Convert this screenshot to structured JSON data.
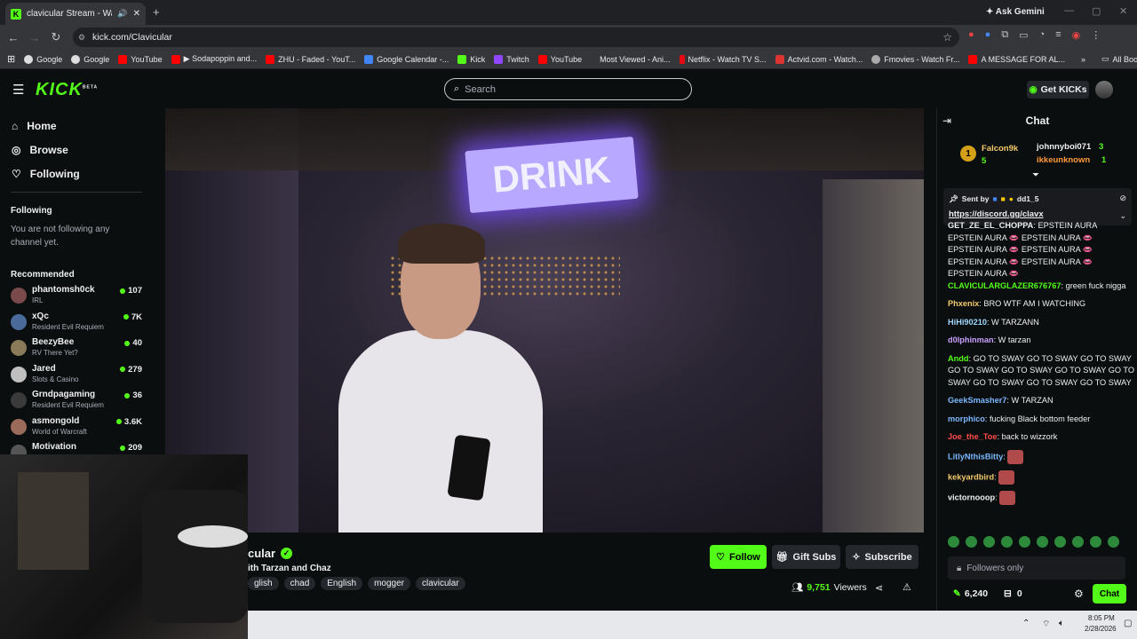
{
  "browser": {
    "tab_title": "clavicular Stream - Watch Li",
    "url": "kick.com/Clavicular",
    "ask_gemini": "Ask Gemini",
    "bookmarks": [
      "Google",
      "Google",
      "YouTube",
      "▶ Sodapoppin and...",
      "ZHU - Faded - YouT...",
      "Google Calendar -...",
      "Kick",
      "Twitch",
      "YouTube",
      "Most Viewed - Ani...",
      "Netflix - Watch TV S...",
      "Actvid.com - Watch...",
      "Fmovies - Watch Fr...",
      "A MESSAGE FOR AL..."
    ],
    "all_bookmarks": "All Bookmarks"
  },
  "header": {
    "logo": "KICK",
    "logo_sup": "BETA",
    "search_placeholder": "Search",
    "get_kicks": "Get KICKs"
  },
  "sidebar": {
    "nav": [
      {
        "label": "Home",
        "icon": "home-icon"
      },
      {
        "label": "Browse",
        "icon": "compass-icon"
      },
      {
        "label": "Following",
        "icon": "heart-icon"
      }
    ],
    "following_title": "Following",
    "following_empty": "You are not following any channel yet.",
    "recommended_title": "Recommended",
    "recommended": [
      {
        "name": "phantomsh0ck",
        "category": "IRL",
        "viewers": "107",
        "color": "#7a4a4a"
      },
      {
        "name": "xQc",
        "category": "Resident Evil Requiem",
        "viewers": "7K",
        "color": "#4a6a9a"
      },
      {
        "name": "BeezyBee",
        "category": "RV There Yet?",
        "viewers": "40",
        "color": "#8a7a5a"
      },
      {
        "name": "Jared",
        "category": "Slots & Casino",
        "viewers": "279",
        "color": "#c0c0c0"
      },
      {
        "name": "Grndpagaming",
        "category": "Resident Evil Requiem",
        "viewers": "36",
        "color": "#3a3a3a"
      },
      {
        "name": "asmongold",
        "category": "World of Warcraft",
        "viewers": "3.6K",
        "color": "#9a6a5a"
      },
      {
        "name": "Motivation",
        "category": "",
        "viewers": "209",
        "color": "#555555"
      }
    ]
  },
  "video": {
    "sign_text": "DRINK"
  },
  "stream_info": {
    "channel_name": "cular",
    "title": "ith Tarzan and Chaz",
    "tags": [
      "glish",
      "chad",
      "English",
      "mogger",
      "clavicular"
    ],
    "follow": "Follow",
    "gift_subs": "Gift Subs",
    "subscribe": "Subscribe",
    "viewers_count": "9,751",
    "viewers_label": "Viewers"
  },
  "chat": {
    "title": "Chat",
    "leaderboard": {
      "first": {
        "rank": "1",
        "name": "Falcon9k",
        "count": "5"
      },
      "second": {
        "name": "johnnyboi071",
        "count": "3"
      },
      "third": {
        "name": "ikkeunknown",
        "count": "1"
      }
    },
    "pinned": {
      "sent_by": "Sent by",
      "sender": "dd1_5",
      "link": "https://discord.gg/clavx"
    },
    "messages": [
      {
        "user": "GET_ZE_EL_CHOPPA",
        "color": "#efeff1",
        "text": "EPSTEIN AURA"
      },
      {
        "user": "",
        "color": "#efeff1",
        "text": "EPSTEIN AURA 👄 EPSTEIN AURA 👄"
      },
      {
        "user": "",
        "color": "#efeff1",
        "text": "EPSTEIN AURA 👄 EPSTEIN AURA 👄"
      },
      {
        "user": "",
        "color": "#efeff1",
        "text": "EPSTEIN AURA 👄 EPSTEIN AURA 👄"
      },
      {
        "user": "",
        "color": "#efeff1",
        "text": "EPSTEIN AURA 👄"
      },
      {
        "user": "CLAVICULARGLAZER676767",
        "color": "#53fc18",
        "text": "green fuck nigga"
      },
      {
        "user": "Phxenix",
        "color": "#f3c96b",
        "text": "BRO WTF AM I WATCHING"
      },
      {
        "user": "HiHi90210",
        "color": "#a0d8ff",
        "text": "W TARZANN"
      },
      {
        "user": "d0lphinman",
        "color": "#c8a0ff",
        "text": "W tarzan"
      },
      {
        "user": "Andd",
        "color": "#53fc18",
        "text": "GO TO SWAY GO TO SWAY GO TO SWAY GO TO SWAY GO TO SWAY GO TO SWAY GO TO SWAY GO TO SWAY GO TO SWAY GO TO SWAY"
      },
      {
        "user": "GeekSmasher7",
        "color": "#7ab8ff",
        "text": "W TARZAN"
      },
      {
        "user": "morphico",
        "color": "#7ab8ff",
        "text": "fucking Black bottom feeder"
      },
      {
        "user": "Joe_the_Toe",
        "color": "#ff4a4a",
        "text": "back to wizzork"
      },
      {
        "user": "LitlyNthisBitty",
        "color": "#7ab8ff",
        "text": ""
      },
      {
        "user": "kekyardbird",
        "color": "#f3c96b",
        "text": ""
      },
      {
        "user": "victornooop",
        "color": "#efeff1",
        "text": ""
      }
    ],
    "followers_only": "Followers only",
    "kicks_balance": "6,240",
    "gift_count": "0",
    "chat_button": "Chat"
  },
  "taskbar": {
    "time": "8:05 PM",
    "date": "2/28/2026"
  }
}
